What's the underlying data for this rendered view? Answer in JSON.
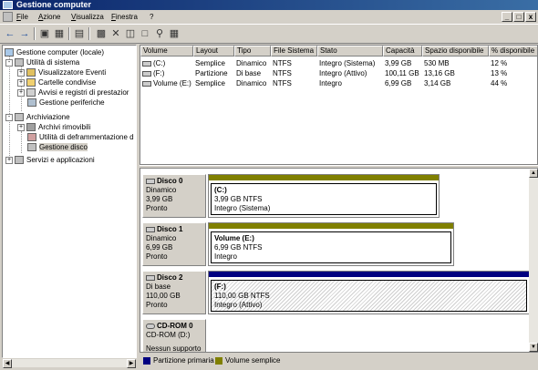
{
  "window": {
    "title": "Gestione computer"
  },
  "menu": [
    "File",
    "Azione",
    "Visualizza",
    "Finestra",
    "?"
  ],
  "window_buttons": [
    "_",
    "□",
    "x"
  ],
  "tree": {
    "root": "Gestione computer (locale)",
    "items": [
      {
        "label": "Utilità di sistema",
        "expander": "-"
      },
      {
        "label": "Visualizzatore Eventi",
        "expander": "+"
      },
      {
        "label": "Cartelle condivise",
        "expander": "+"
      },
      {
        "label": "Avvisi e registri di prestazior",
        "expander": "+"
      },
      {
        "label": "Gestione periferiche",
        "expander": ""
      },
      {
        "label": "Archiviazione",
        "expander": "-"
      },
      {
        "label": "Archivi rimovibili",
        "expander": "+"
      },
      {
        "label": "Utilità di deframmentazione d",
        "expander": ""
      },
      {
        "label": "Gestione disco",
        "expander": ""
      },
      {
        "label": "Servizi e applicazioni",
        "expander": "+"
      }
    ]
  },
  "volumes": {
    "headers": [
      "Volume",
      "Layout",
      "Tipo",
      "File Sistema",
      "Stato",
      "Capacità",
      "Spazio disponibile",
      "% disponibile"
    ],
    "rows": [
      [
        "(C:)",
        "Semplice",
        "Dinamico",
        "NTFS",
        "Integro (Sistema)",
        "3,99 GB",
        "530 MB",
        "12 %"
      ],
      [
        "(F:)",
        "Partizione",
        "Di base",
        "NTFS",
        "Integro (Attivo)",
        "100,11 GB",
        "13,16 GB",
        "13 %"
      ],
      [
        "Volume (E:)",
        "Semplice",
        "Dinamico",
        "NTFS",
        "Integro",
        "6,99 GB",
        "3,14 GB",
        "44 %"
      ]
    ]
  },
  "disks": [
    {
      "name": "Disco 0",
      "type": "Dinamico",
      "size": "3,99 GB",
      "status": "Pronto",
      "part": {
        "name": "(C:)",
        "info": "3,99 GB NTFS",
        "status": "Integro (Sistema)",
        "color": "#808000"
      }
    },
    {
      "name": "Disco 1",
      "type": "Dinamico",
      "size": "6,99 GB",
      "status": "Pronto",
      "part": {
        "name": "Volume  (E:)",
        "info": "6,99 GB NTFS",
        "status": "Integro",
        "color": "#808000"
      }
    },
    {
      "name": "Disco 2",
      "type": "Di base",
      "size": "110,00 GB",
      "status": "Pronto",
      "part": {
        "name": "(F:)",
        "info": "110,00 GB NTFS",
        "status": "Integro (Attivo)",
        "color": "#000080"
      }
    },
    {
      "name": "CD-ROM 0",
      "type": "CD-ROM (D:)",
      "size": "",
      "status": "Nessun supporto"
    }
  ],
  "legend": [
    {
      "label": "Partizione primaria",
      "color": "#000080"
    },
    {
      "label": "Volume semplice",
      "color": "#808000"
    }
  ]
}
